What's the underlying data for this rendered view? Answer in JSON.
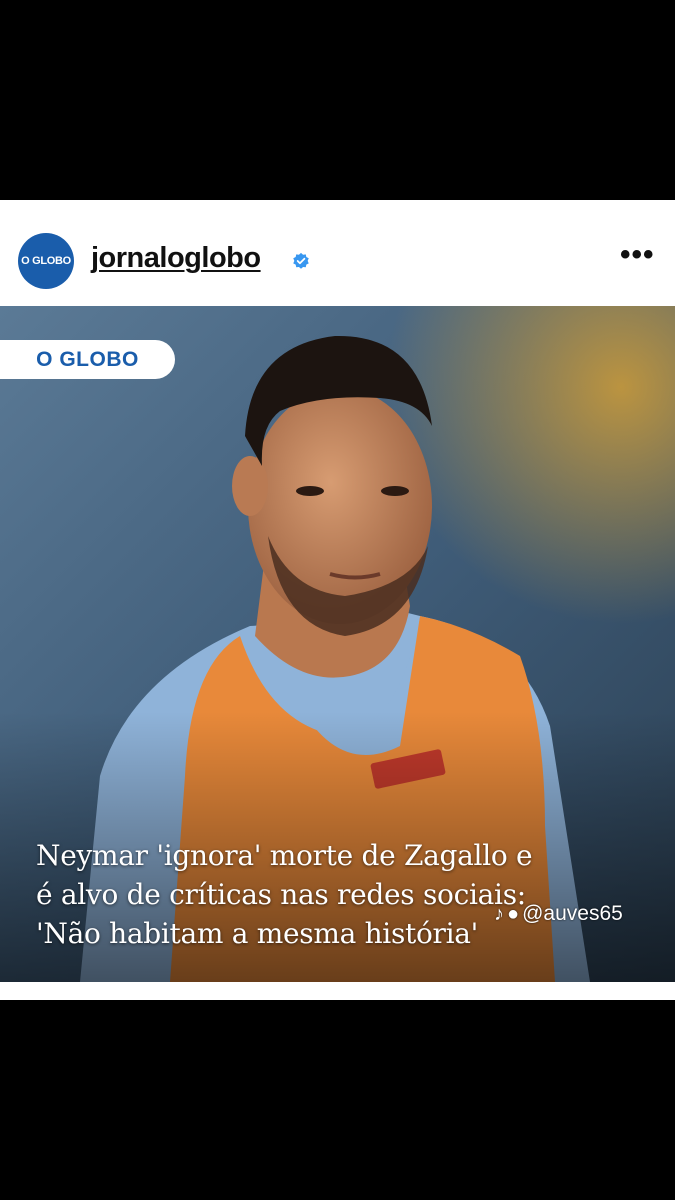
{
  "post": {
    "username": "jornaloglobo",
    "avatar_text": "O GLOBO",
    "verified_icon": "verified-badge-icon",
    "more_label": "•••",
    "brand_label": "O GLOBO",
    "headline_lines": [
      "Neymar 'ignora' morte de Zagallo e",
      "é alvo de críticas nas redes sociais:",
      "'Não habitam a mesma história'"
    ],
    "watermark": "@auves65",
    "colors": {
      "brand_blue": "#1a5dab",
      "verified_blue": "#3897f0",
      "bib_orange": "#e8893a",
      "shirt_blue": "#8fb3d9"
    }
  }
}
